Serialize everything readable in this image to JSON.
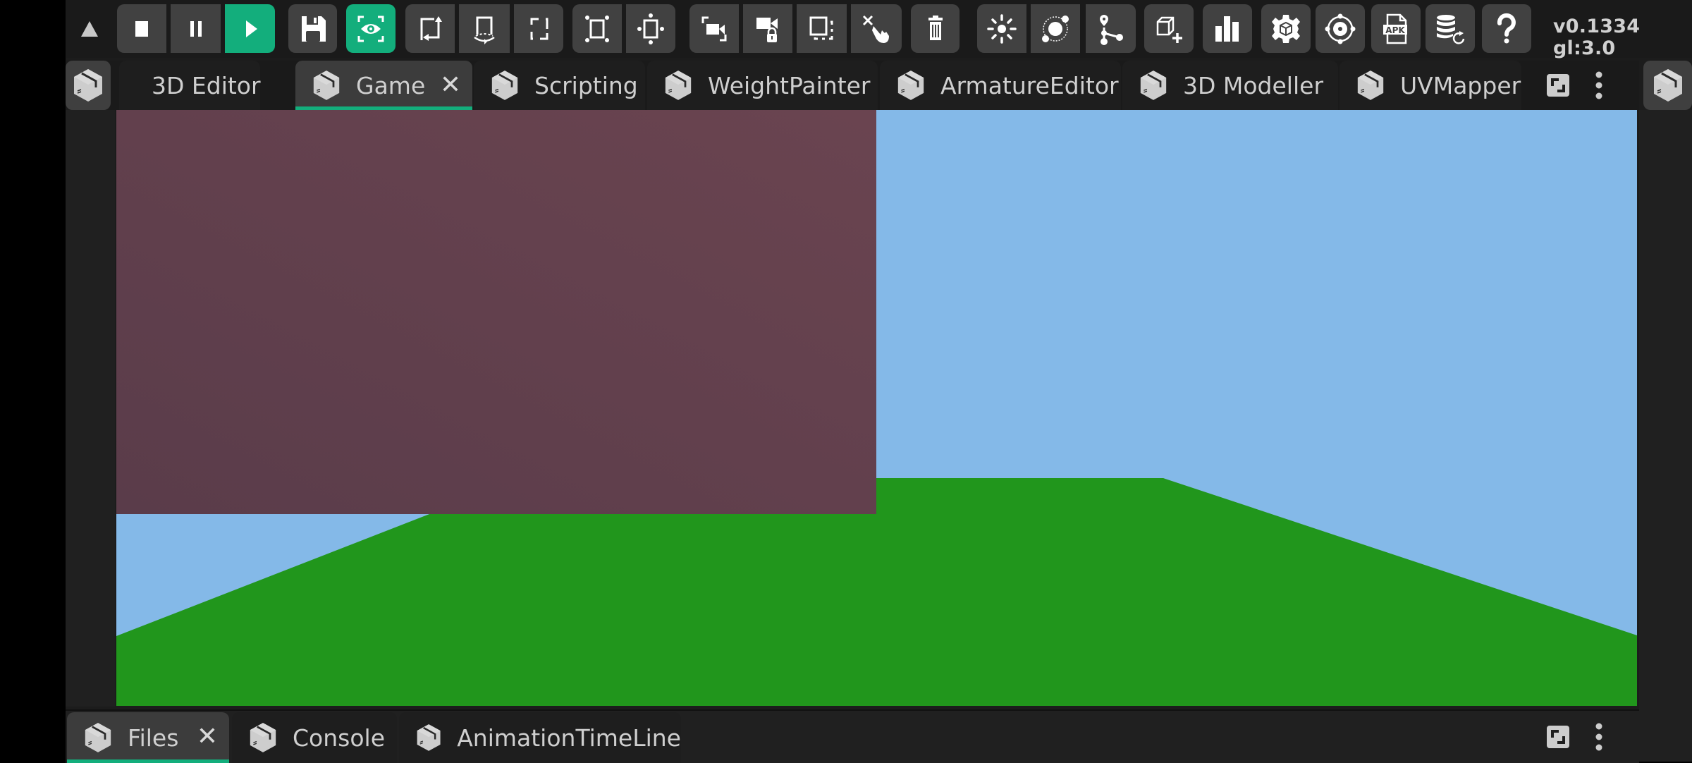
{
  "toolbar": {
    "collapse_icon": "triangle-up-icon",
    "buttons": [
      {
        "name": "stop",
        "icon": "stop-icon",
        "active": false
      },
      {
        "name": "pause",
        "icon": "pause-icon",
        "active": false
      },
      {
        "name": "play",
        "icon": "play-icon",
        "active": true
      },
      {
        "name": "save",
        "icon": "floppy-disk-icon",
        "active": false
      },
      {
        "name": "view-toggle",
        "icon": "eye-frame-icon",
        "active": true
      },
      {
        "name": "reset-transform",
        "icon": "frame-rotate-icon",
        "active": false
      },
      {
        "name": "rotate-around",
        "icon": "orbit-rotate-icon",
        "active": false
      },
      {
        "name": "frame-brackets",
        "icon": "bracket-frame-icon",
        "active": false
      },
      {
        "name": "scale-handles",
        "icon": "scale-handles-icon",
        "active": false
      },
      {
        "name": "move-handles",
        "icon": "move-handles-icon",
        "active": false
      },
      {
        "name": "camera-frame",
        "icon": "camera-frame-icon",
        "active": false
      },
      {
        "name": "camera-lock",
        "icon": "camera-lock-icon",
        "active": false
      },
      {
        "name": "select-region",
        "icon": "dashed-select-icon",
        "active": false
      },
      {
        "name": "touch-delete",
        "icon": "touch-cross-icon",
        "active": false
      },
      {
        "name": "delete",
        "icon": "trash-icon",
        "active": false
      },
      {
        "name": "light",
        "icon": "sun-icon",
        "active": false
      },
      {
        "name": "orbit",
        "icon": "orbit-icon",
        "active": false
      },
      {
        "name": "path-graph",
        "icon": "graph-nodes-icon",
        "active": false
      },
      {
        "name": "add-object",
        "icon": "cube-add-icon",
        "active": false
      },
      {
        "name": "stats",
        "icon": "bar-chart-icon",
        "active": false
      },
      {
        "name": "object-settings",
        "icon": "gear-cube-icon",
        "active": false
      },
      {
        "name": "global-settings",
        "icon": "target-gear-icon",
        "active": false
      },
      {
        "name": "build-apk",
        "icon": "apk-file-icon",
        "active": false
      },
      {
        "name": "database-refresh",
        "icon": "database-refresh-icon",
        "active": false
      },
      {
        "name": "help",
        "icon": "question-mark-icon",
        "active": false
      }
    ],
    "version_text": "v0.1334 gl:3.0"
  },
  "top_tabs": [
    {
      "label": "3D Editor",
      "active": false
    },
    {
      "label": "Game",
      "active": true,
      "closable": true
    },
    {
      "label": "Scripting",
      "active": false
    },
    {
      "label": "WeightPainter",
      "active": false
    },
    {
      "label": "ArmatureEditor",
      "active": false
    },
    {
      "label": "3D Modeller",
      "active": false
    },
    {
      "label": "UVMapper",
      "active": false
    }
  ],
  "tab_close_glyph": "✕",
  "bottom_tabs": [
    {
      "label": "Files",
      "active": true,
      "closable": true
    },
    {
      "label": "Console",
      "active": false
    },
    {
      "label": "AnimationTimeLine",
      "active": false
    }
  ],
  "colors": {
    "accent": "#13ae7c",
    "sky": "#84b9e8",
    "ground": "#21961c",
    "wall_light": "#6a4450",
    "wall_dark": "#5a3c4a",
    "button_bg": "#414141"
  }
}
